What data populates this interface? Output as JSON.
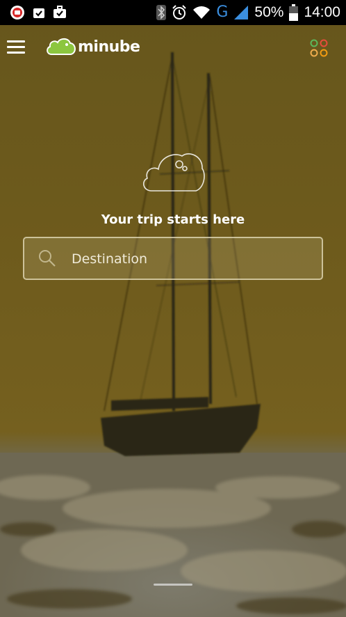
{
  "status_bar": {
    "battery_text": "50%",
    "time": "14:00",
    "network_letter": "G",
    "icons": [
      "notification-app-icon",
      "clipboard-check-icon",
      "briefcase-check-icon",
      "bluetooth-icon",
      "alarm-icon",
      "wifi-icon",
      "signal-icon",
      "battery-icon"
    ]
  },
  "app_bar": {
    "brand": "minube",
    "menu_icon": "hamburger-icon",
    "apps_icon": "apps-grid-icon"
  },
  "hero": {
    "tagline": "Your trip starts here",
    "icon": "cloud-icon"
  },
  "search": {
    "placeholder": "Destination",
    "icon": "search-icon"
  },
  "colors": {
    "status_bar_bg": "#000000",
    "logo_green": "#8cc63f",
    "network_blue": "#3b8fe0",
    "apps_dots": [
      "#5cb85c",
      "#e74c3c",
      "#f0ad4e",
      "#f39c12"
    ]
  }
}
